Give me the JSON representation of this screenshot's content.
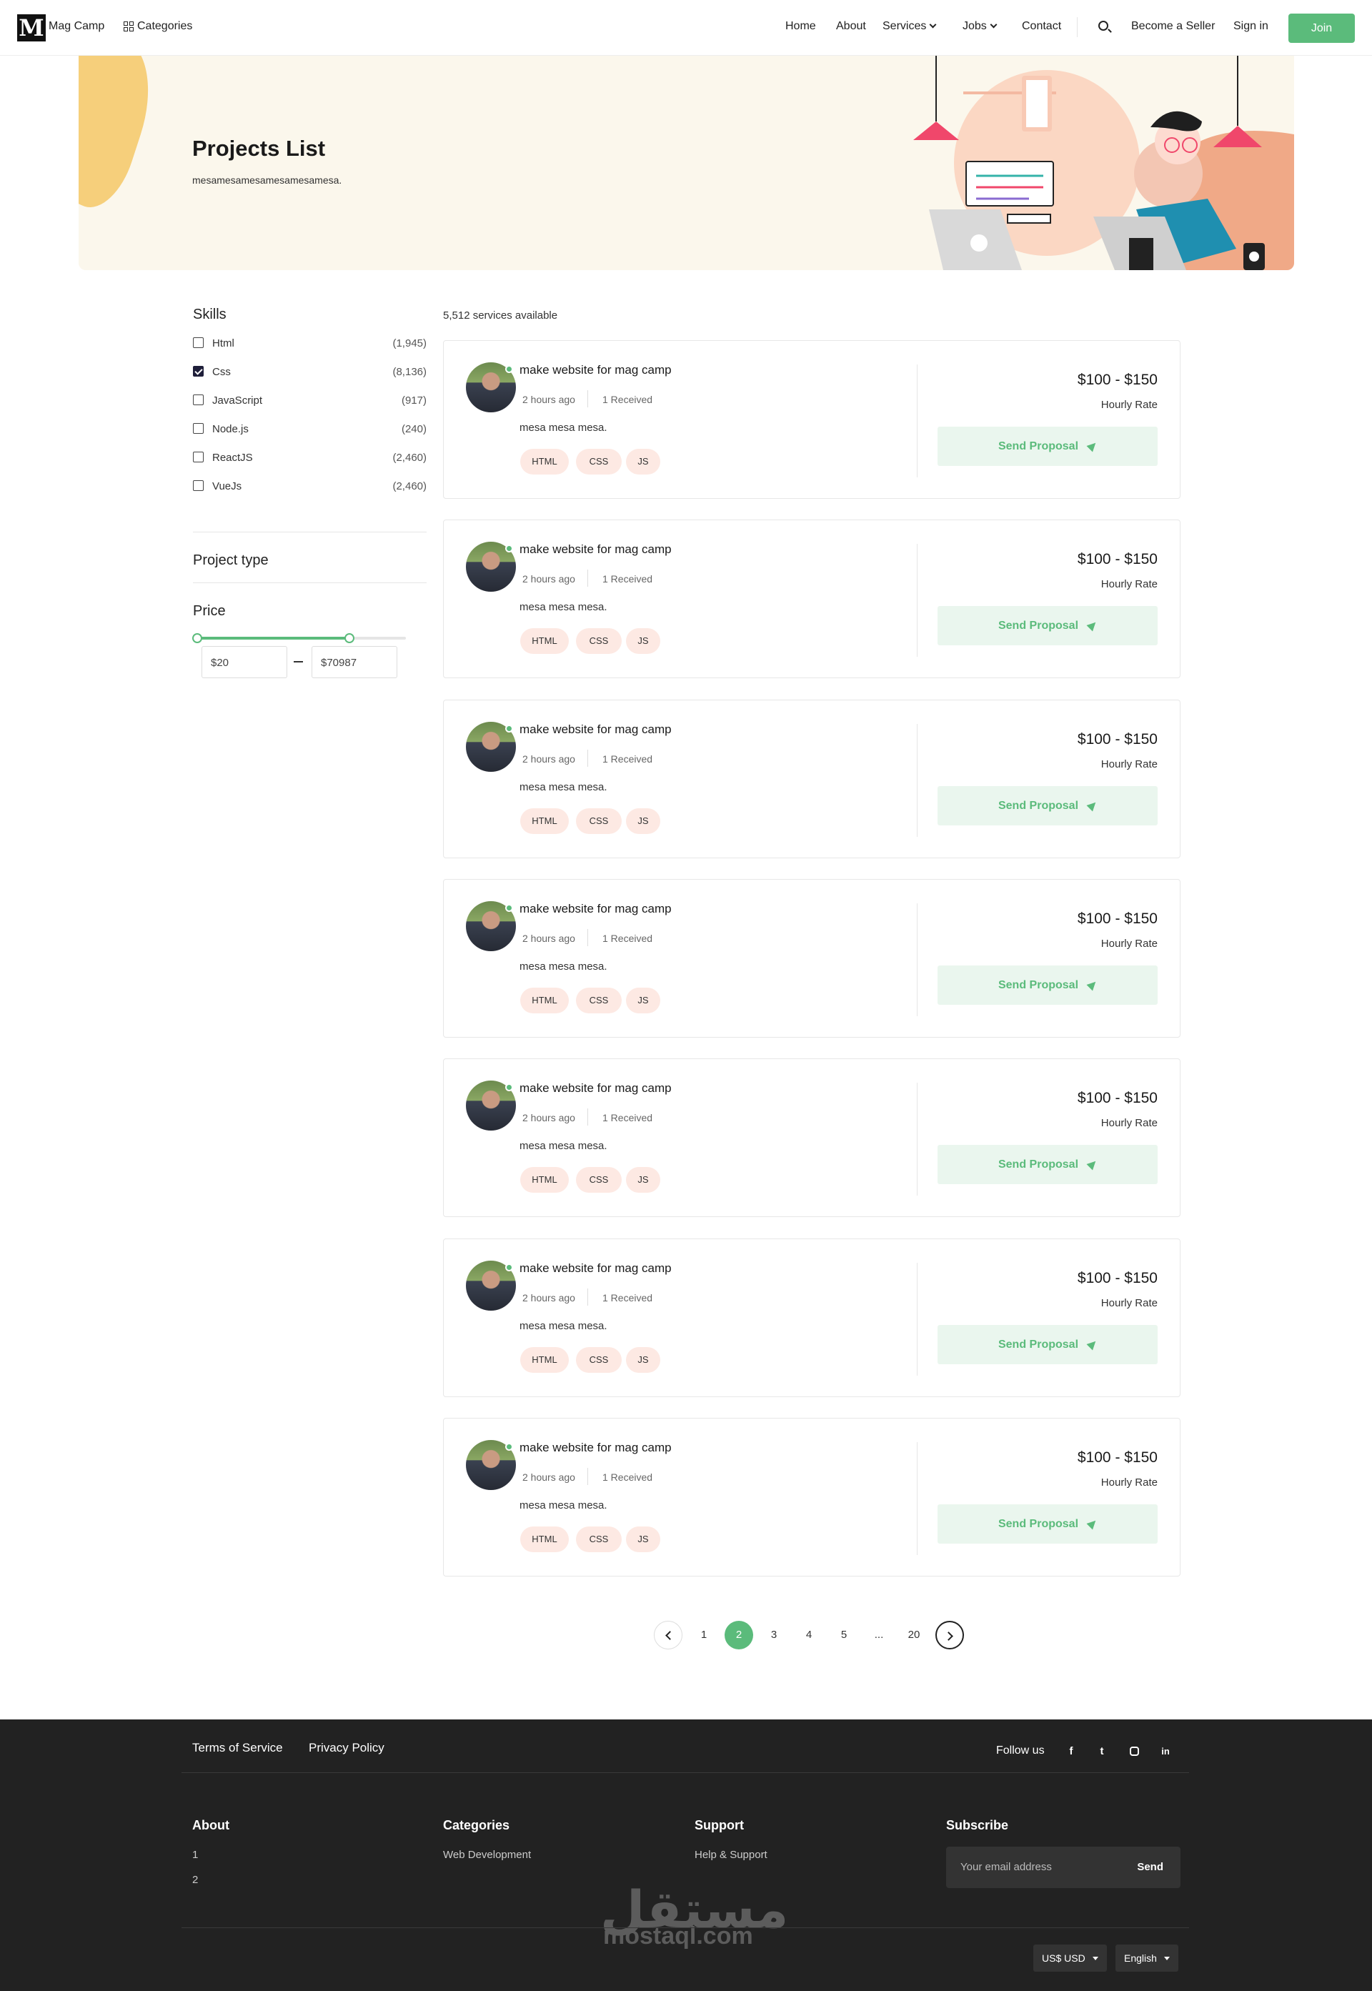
{
  "header": {
    "logo_letter": "M",
    "brand": "Mag Camp",
    "categories": "Categories",
    "nav": [
      "Home",
      "About",
      "Services",
      "Jobs",
      "Contact"
    ],
    "become_seller": "Become a Seller",
    "sign_in": "Sign in",
    "join": "Join"
  },
  "hero": {
    "title": "Projects List",
    "subtitle": "mesamesamesamesamesamesa."
  },
  "sidebar": {
    "skills_title": "Skills",
    "skills": [
      {
        "label": "Html",
        "count": "(1,945)",
        "checked": false
      },
      {
        "label": "Css",
        "count": "(8,136)",
        "checked": true
      },
      {
        "label": "JavaScript",
        "count": "(917)",
        "checked": false
      },
      {
        "label": "Node.js",
        "count": "(240)",
        "checked": false
      },
      {
        "label": "ReactJS",
        "count": "(2,460)",
        "checked": false
      },
      {
        "label": "VueJs",
        "count": "(2,460)",
        "checked": false
      }
    ],
    "project_type_title": "Project type",
    "price_title": "Price",
    "price_min": "$20",
    "price_max": "$70987",
    "range_fraction": [
      0,
      0.73
    ]
  },
  "listing": {
    "available": "5,512 services available",
    "projects": [
      {
        "title": "make website for mag camp",
        "time": "2 hours ago",
        "received": "1 Received",
        "desc": "mesa mesa mesa.",
        "tags": [
          "HTML",
          "CSS",
          "JS"
        ],
        "price": "$100 - $150",
        "rate": "Hourly Rate",
        "cta": "Send Proposal"
      },
      {
        "title": "make website for mag camp",
        "time": "2 hours ago",
        "received": "1 Received",
        "desc": "mesa mesa mesa.",
        "tags": [
          "HTML",
          "CSS",
          "JS"
        ],
        "price": "$100 - $150",
        "rate": "Hourly Rate",
        "cta": "Send Proposal"
      },
      {
        "title": "make website for mag camp",
        "time": "2 hours ago",
        "received": "1 Received",
        "desc": "mesa mesa mesa.",
        "tags": [
          "HTML",
          "CSS",
          "JS"
        ],
        "price": "$100 - $150",
        "rate": "Hourly Rate",
        "cta": "Send Proposal"
      },
      {
        "title": "make website for mag camp",
        "time": "2 hours ago",
        "received": "1 Received",
        "desc": "mesa mesa mesa.",
        "tags": [
          "HTML",
          "CSS",
          "JS"
        ],
        "price": "$100 - $150",
        "rate": "Hourly Rate",
        "cta": "Send Proposal"
      },
      {
        "title": "make website for mag camp",
        "time": "2 hours ago",
        "received": "1 Received",
        "desc": "mesa mesa mesa.",
        "tags": [
          "HTML",
          "CSS",
          "JS"
        ],
        "price": "$100 - $150",
        "rate": "Hourly Rate",
        "cta": "Send Proposal"
      },
      {
        "title": "make website for mag camp",
        "time": "2 hours ago",
        "received": "1 Received",
        "desc": "mesa mesa mesa.",
        "tags": [
          "HTML",
          "CSS",
          "JS"
        ],
        "price": "$100 - $150",
        "rate": "Hourly Rate",
        "cta": "Send Proposal"
      },
      {
        "title": "make website for mag camp",
        "time": "2 hours ago",
        "received": "1 Received",
        "desc": "mesa mesa mesa.",
        "tags": [
          "HTML",
          "CSS",
          "JS"
        ],
        "price": "$100 - $150",
        "rate": "Hourly Rate",
        "cta": "Send Proposal"
      }
    ]
  },
  "pagination": {
    "pages": [
      "1",
      "2",
      "3",
      "4",
      "5",
      "...",
      "20"
    ],
    "current": "2"
  },
  "footer": {
    "terms": "Terms of Service",
    "privacy": "Privacy Policy",
    "follow": "Follow us",
    "social_icons": [
      "facebook-icon",
      "twitter-icon",
      "instagram-icon",
      "linkedin-icon"
    ],
    "about_title": "About",
    "about_items": [
      "1",
      "2"
    ],
    "categories_title": "Categories",
    "categories_items": [
      "Web Development"
    ],
    "support_title": "Support",
    "support_items": [
      "Help & Support"
    ],
    "subscribe_title": "Subscribe",
    "email_placeholder": "Your email address",
    "send": "Send",
    "currency": "US$ USD",
    "language": "English",
    "watermark_ar": "مستقل",
    "watermark_en": "mostaql.com"
  },
  "colors": {
    "accent": "#5bbb7b",
    "tag_bg": "#fde9e3",
    "footer_bg": "#222222",
    "hero_bg": "#fbf7ec"
  }
}
